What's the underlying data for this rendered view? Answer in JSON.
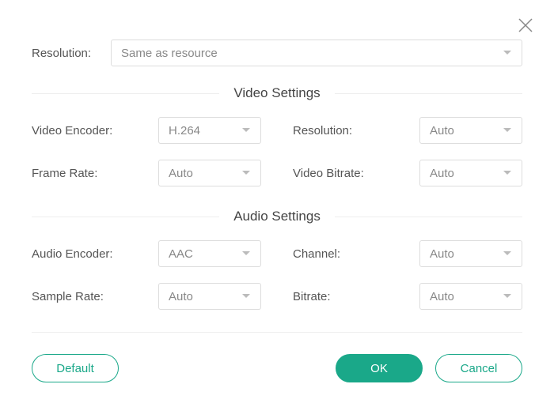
{
  "topResolution": {
    "label": "Resolution:",
    "value": "Same as resource"
  },
  "videoSection": {
    "title": "Video Settings",
    "fields": {
      "videoEncoder": {
        "label": "Video Encoder:",
        "value": "H.264"
      },
      "resolution": {
        "label": "Resolution:",
        "value": "Auto"
      },
      "frameRate": {
        "label": "Frame Rate:",
        "value": "Auto"
      },
      "videoBitrate": {
        "label": "Video Bitrate:",
        "value": "Auto"
      }
    }
  },
  "audioSection": {
    "title": "Audio Settings",
    "fields": {
      "audioEncoder": {
        "label": "Audio Encoder:",
        "value": "AAC"
      },
      "channel": {
        "label": "Channel:",
        "value": "Auto"
      },
      "sampleRate": {
        "label": "Sample Rate:",
        "value": "Auto"
      },
      "bitrate": {
        "label": "Bitrate:",
        "value": "Auto"
      }
    }
  },
  "buttons": {
    "default": "Default",
    "ok": "OK",
    "cancel": "Cancel"
  }
}
